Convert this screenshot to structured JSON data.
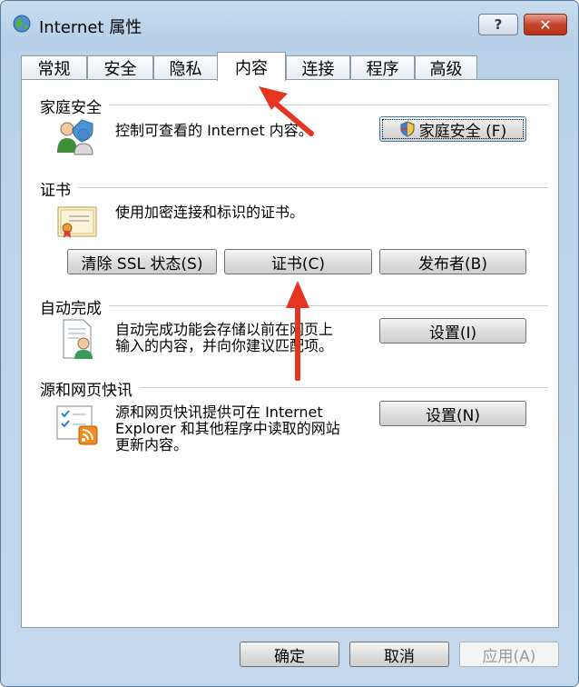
{
  "window": {
    "title": "Internet 属性",
    "help_label": "?",
    "close_label": "✕"
  },
  "tabs": [
    {
      "label": "常规"
    },
    {
      "label": "安全"
    },
    {
      "label": "隐私"
    },
    {
      "label": "内容"
    },
    {
      "label": "连接"
    },
    {
      "label": "程序"
    },
    {
      "label": "高级"
    }
  ],
  "active_tab": "内容",
  "family_safety": {
    "title": "家庭安全",
    "description": "控制可查看的 Internet 内容。",
    "button": "家庭安全 (F)",
    "icon": "family-safety-icon"
  },
  "certificates": {
    "title": "证书",
    "description": "使用加密连接和标识的证书。",
    "buttons": {
      "clear_ssl": "清除 SSL 状态(S)",
      "certificates": "证书(C)",
      "publishers": "发布者(B)"
    },
    "icon": "certificate-icon"
  },
  "autocomplete": {
    "title": "自动完成",
    "description_line1": "自动完成功能会存储以前在网页上",
    "description_line2": "输入的内容，并向你建议匹配项。",
    "button": "设置(I)",
    "icon": "autocomplete-icon"
  },
  "feeds": {
    "title": "源和网页快讯",
    "description_line1": "源和网页快讯提供可在 Internet",
    "description_line2": "Explorer 和其他程序中读取的网站",
    "description_line3": "更新内容。",
    "button": "设置(N)",
    "icon": "rss-feed-icon"
  },
  "footer": {
    "ok": "确定",
    "cancel": "取消",
    "apply": "应用(A)"
  },
  "colors": {
    "annotation_arrow": "#e53422",
    "titlebar": "#b9d1e8",
    "close_button": "#c6452e"
  }
}
